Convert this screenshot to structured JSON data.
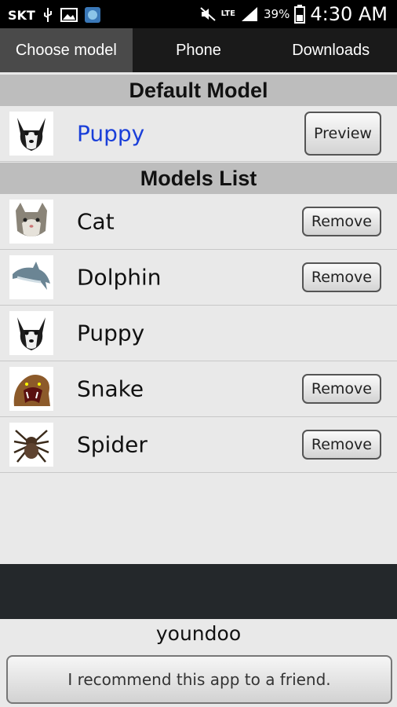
{
  "status_bar": {
    "carrier": "SKT",
    "network": "LTE",
    "battery_pct": "39%",
    "time": "4:30 AM"
  },
  "tabs": [
    {
      "label": "Choose model",
      "selected": true
    },
    {
      "label": "Phone",
      "selected": false
    },
    {
      "label": "Downloads",
      "selected": false
    }
  ],
  "default_model": {
    "header": "Default Model",
    "name": "Puppy",
    "button": "Preview"
  },
  "models_list": {
    "header": "Models List",
    "items": [
      {
        "name": "Cat",
        "button": "Remove",
        "icon": "cat-icon"
      },
      {
        "name": "Dolphin",
        "button": "Remove",
        "icon": "dolphin-icon"
      },
      {
        "name": "Puppy",
        "button": "",
        "icon": "puppy-icon"
      },
      {
        "name": "Snake",
        "button": "Remove",
        "icon": "snake-icon"
      },
      {
        "name": "Spider",
        "button": "Remove",
        "icon": "spider-icon"
      }
    ]
  },
  "footer": {
    "name": "youndoo",
    "recommend_button": "I recommend this app to a friend."
  }
}
